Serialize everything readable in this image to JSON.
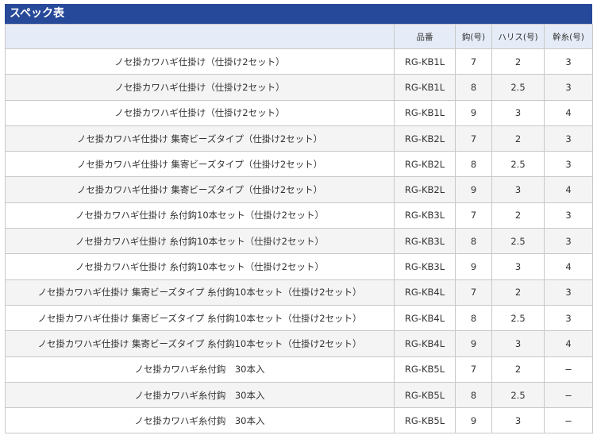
{
  "title": "スペック表",
  "headers": {
    "name": "",
    "code": "品番",
    "hook": "鈎(号)",
    "harris": "ハリス(号)",
    "mainline": "幹糸(号)"
  },
  "rows": [
    {
      "name": "ノセ掛カワハギ仕掛け（仕掛け2セット）",
      "code": "RG-KB1L",
      "hook": "7",
      "harris": "2",
      "mainline": "3"
    },
    {
      "name": "ノセ掛カワハギ仕掛け（仕掛け2セット）",
      "code": "RG-KB1L",
      "hook": "8",
      "harris": "2.5",
      "mainline": "3"
    },
    {
      "name": "ノセ掛カワハギ仕掛け（仕掛け2セット）",
      "code": "RG-KB1L",
      "hook": "9",
      "harris": "3",
      "mainline": "4"
    },
    {
      "name": "ノセ掛カワハギ仕掛け 集寄ビーズタイプ（仕掛け2セット）",
      "code": "RG-KB2L",
      "hook": "7",
      "harris": "2",
      "mainline": "3"
    },
    {
      "name": "ノセ掛カワハギ仕掛け 集寄ビーズタイプ（仕掛け2セット）",
      "code": "RG-KB2L",
      "hook": "8",
      "harris": "2.5",
      "mainline": "3"
    },
    {
      "name": "ノセ掛カワハギ仕掛け 集寄ビーズタイプ（仕掛け2セット）",
      "code": "RG-KB2L",
      "hook": "9",
      "harris": "3",
      "mainline": "4"
    },
    {
      "name": "ノセ掛カワハギ仕掛け 糸付鈎10本セット（仕掛け2セット）",
      "code": "RG-KB3L",
      "hook": "7",
      "harris": "2",
      "mainline": "3"
    },
    {
      "name": "ノセ掛カワハギ仕掛け 糸付鈎10本セット（仕掛け2セット）",
      "code": "RG-KB3L",
      "hook": "8",
      "harris": "2.5",
      "mainline": "3"
    },
    {
      "name": "ノセ掛カワハギ仕掛け 糸付鈎10本セット（仕掛け2セット）",
      "code": "RG-KB3L",
      "hook": "9",
      "harris": "3",
      "mainline": "4"
    },
    {
      "name": "ノセ掛カワハギ仕掛け 集寄ビーズタイプ 糸付鈎10本セット（仕掛け2セット）",
      "code": "RG-KB4L",
      "hook": "7",
      "harris": "2",
      "mainline": "3"
    },
    {
      "name": "ノセ掛カワハギ仕掛け 集寄ビーズタイプ 糸付鈎10本セット（仕掛け2セット）",
      "code": "RG-KB4L",
      "hook": "8",
      "harris": "2.5",
      "mainline": "3"
    },
    {
      "name": "ノセ掛カワハギ仕掛け 集寄ビーズタイプ 糸付鈎10本セット（仕掛け2セット）",
      "code": "RG-KB4L",
      "hook": "9",
      "harris": "3",
      "mainline": "4"
    },
    {
      "name": "ノセ掛カワハギ糸付鈎　30本入",
      "code": "RG-KB5L",
      "hook": "7",
      "harris": "2",
      "mainline": "−"
    },
    {
      "name": "ノセ掛カワハギ糸付鈎　30本入",
      "code": "RG-KB5L",
      "hook": "8",
      "harris": "2.5",
      "mainline": "−"
    },
    {
      "name": "ノセ掛カワハギ糸付鈎　30本入",
      "code": "RG-KB5L",
      "hook": "9",
      "harris": "3",
      "mainline": "−"
    }
  ]
}
